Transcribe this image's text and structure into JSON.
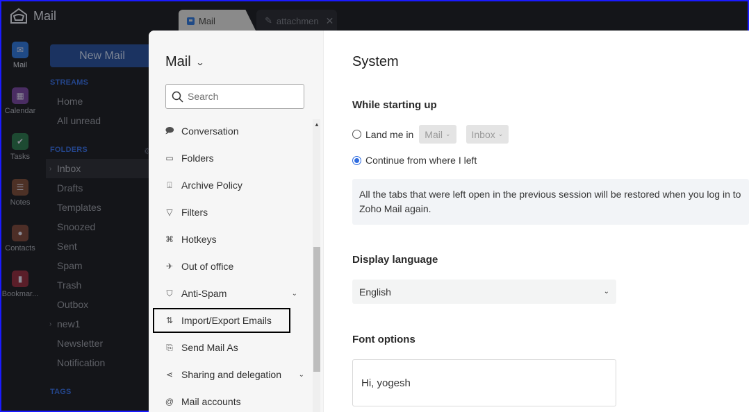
{
  "app": {
    "brand": "Mail",
    "brand_icon": "mail-envelope-icon",
    "tabs": [
      {
        "label": "Mail",
        "icon": "mail-icon",
        "active": true
      },
      {
        "label": "attachmen",
        "icon": "pencil-icon",
        "active": false,
        "close_icon": "close-icon"
      }
    ]
  },
  "rail": [
    {
      "label": "Mail",
      "icon": "mail-icon",
      "color": "#1f4a86"
    },
    {
      "label": "Calendar",
      "icon": "calendar-icon",
      "color": "#4a2d63"
    },
    {
      "label": "Tasks",
      "icon": "check-icon",
      "color": "#1d4a32"
    },
    {
      "label": "Notes",
      "icon": "notes-icon",
      "color": "#4d3126"
    },
    {
      "label": "Contacts",
      "icon": "contact-icon",
      "color": "#4d2e27"
    },
    {
      "label": "Bookmar...",
      "icon": "bookmark-icon",
      "color": "#5a1e29"
    }
  ],
  "folders_panel": {
    "new_mail": "New Mail",
    "streams_title": "STREAMS",
    "streams": [
      "Home",
      "All unread"
    ],
    "folders_title": "FOLDERS",
    "folders": [
      {
        "label": "Inbox",
        "expandable": true,
        "selected": true
      },
      {
        "label": "Drafts"
      },
      {
        "label": "Templates"
      },
      {
        "label": "Snoozed"
      },
      {
        "label": "Sent"
      },
      {
        "label": "Spam"
      },
      {
        "label": "Trash"
      },
      {
        "label": "Outbox"
      },
      {
        "label": "new1",
        "expandable": true
      },
      {
        "label": "Newsletter"
      },
      {
        "label": "Notification"
      }
    ],
    "tags_title": "TAGS"
  },
  "settings": {
    "menu_title": "Mail",
    "search_placeholder": "Search",
    "menu_items": [
      {
        "label": "Conversation",
        "icon": "conversation-icon"
      },
      {
        "label": "Folders",
        "icon": "folder-icon"
      },
      {
        "label": "Archive Policy",
        "icon": "archive-icon"
      },
      {
        "label": "Filters",
        "icon": "filter-icon"
      },
      {
        "label": "Hotkeys",
        "icon": "command-icon"
      },
      {
        "label": "Out of office",
        "icon": "airplane-icon"
      },
      {
        "label": "Anti-Spam",
        "icon": "shield-icon",
        "expandable": true
      },
      {
        "label": "Import/Export Emails",
        "icon": "import-export-icon",
        "highlighted": true
      },
      {
        "label": "Send Mail As",
        "icon": "send-as-icon"
      },
      {
        "label": "Sharing and delegation",
        "icon": "share-icon",
        "expandable": true
      },
      {
        "label": "Mail accounts",
        "icon": "at-icon"
      }
    ],
    "content": {
      "title": "System",
      "startup_title": "While starting up",
      "option_land": "Land me in",
      "land_app": "Mail",
      "land_folder": "Inbox",
      "option_continue": "Continue from where I left",
      "selected_option": "continue",
      "info_text": "All the tabs that were left open in the previous session will be restored when you log in to Zoho Mail again.",
      "language_title": "Display language",
      "language_value": "English",
      "font_title": "Font options",
      "font_preview": "Hi, yogesh"
    }
  }
}
